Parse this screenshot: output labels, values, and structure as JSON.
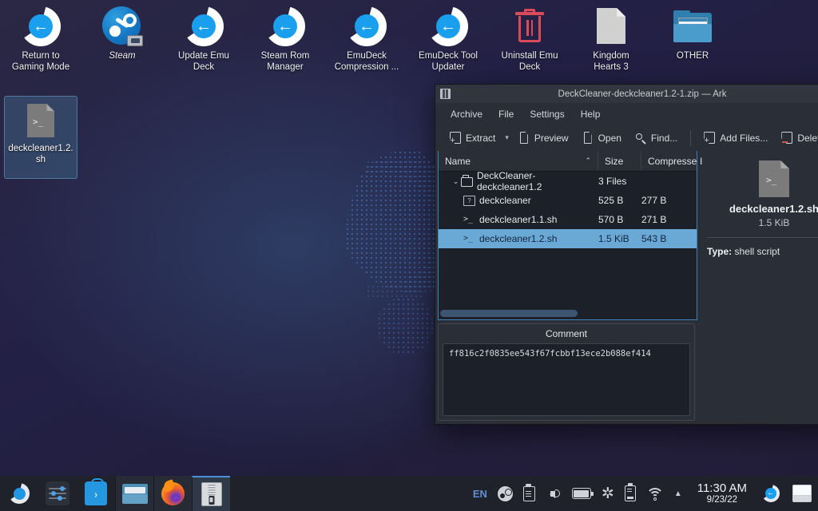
{
  "desktop": {
    "icons": [
      {
        "label": "Return to\nGaming Mode",
        "icon": "return-arrow-icon",
        "italic": false
      },
      {
        "label": "Steam",
        "icon": "steam-icon",
        "italic": true
      },
      {
        "label": "Update Emu\nDeck",
        "icon": "return-arrow-icon",
        "italic": false
      },
      {
        "label": "Steam Rom\nManager",
        "icon": "return-arrow-icon",
        "italic": false
      },
      {
        "label": "EmuDeck\nCompression ...",
        "icon": "return-arrow-icon",
        "italic": false
      },
      {
        "label": "EmuDeck Tool\nUpdater",
        "icon": "return-arrow-icon",
        "italic": false
      },
      {
        "label": "Uninstall Emu\nDeck",
        "icon": "trash-icon",
        "italic": false
      },
      {
        "label": "Kingdom\nHearts 3",
        "icon": "blank-document-icon",
        "italic": false
      },
      {
        "label": "OTHER",
        "icon": "folder-window-icon",
        "italic": false
      }
    ],
    "selected_file": {
      "label": "deckcleaner1.2.\nsh",
      "icon": "shell-script-icon",
      "prompt_glyph": ">_"
    }
  },
  "ark": {
    "title": "DeckCleaner-deckcleaner1.2-1.zip — Ark",
    "app_icon": "ark-icon",
    "menu": [
      "Archive",
      "File",
      "Settings",
      "Help"
    ],
    "toolbar": [
      {
        "label": "Extract",
        "icon": "extract-icon",
        "has_dropdown": true
      },
      {
        "label": "Preview",
        "icon": "preview-icon",
        "has_dropdown": false
      },
      {
        "label": "Open",
        "icon": "open-icon",
        "has_dropdown": false
      },
      {
        "label": "Find...",
        "icon": "search-icon",
        "has_dropdown": false
      },
      {
        "label": "Add Files...",
        "icon": "add-files-icon",
        "has_dropdown": false
      },
      {
        "label": "Delete",
        "icon": "delete-icon",
        "has_dropdown": false
      }
    ],
    "columns": [
      "Name",
      "Size",
      "Compressed"
    ],
    "sort_indicator": "⌃",
    "rows": [
      {
        "name": "DeckCleaner-deckcleaner1.2",
        "size": "3 Files",
        "compressed": "",
        "icon": "folder-icon",
        "depth": 0,
        "expanded": true,
        "selected": false
      },
      {
        "name": "deckcleaner",
        "size": "525 B",
        "compressed": "277 B",
        "icon": "unknown-file-icon",
        "depth": 1,
        "expanded": false,
        "selected": false
      },
      {
        "name": "deckcleaner1.1.sh",
        "size": "570 B",
        "compressed": "271 B",
        "icon": "shell-script-icon",
        "depth": 1,
        "expanded": false,
        "selected": false
      },
      {
        "name": "deckcleaner1.2.sh",
        "size": "1.5 KiB",
        "compressed": "543 B",
        "icon": "shell-script-icon",
        "depth": 1,
        "expanded": false,
        "selected": true
      }
    ],
    "comment": {
      "title": "Comment",
      "text": "ff816c2f0835ee543f67fcbbf13ece2b088ef414"
    },
    "details": {
      "file_name": "deckcleaner1.2.sh",
      "file_size": "1.5 KiB",
      "type_label": "Type:",
      "type_value": "shell script",
      "icon": "shell-script-icon",
      "prompt_glyph": ">_"
    }
  },
  "taskbar": {
    "launchers": [
      {
        "name": "application-launcher",
        "icon": "kde-start-icon"
      },
      {
        "name": "settings",
        "icon": "settings-sliders-icon"
      },
      {
        "name": "discover",
        "icon": "discover-store-icon"
      },
      {
        "name": "file-manager",
        "icon": "dolphin-folder-icon"
      },
      {
        "name": "firefox",
        "icon": "firefox-icon"
      }
    ],
    "tasks": [
      {
        "name": "ark",
        "icon": "zip-archive-icon",
        "active": true
      }
    ],
    "tray": {
      "language": "EN",
      "items": [
        {
          "name": "steam",
          "icon": "steam-tray-icon"
        },
        {
          "name": "clipboard",
          "icon": "clipboard-icon"
        },
        {
          "name": "volume",
          "icon": "volume-icon"
        },
        {
          "name": "battery",
          "icon": "battery-icon"
        },
        {
          "name": "bluetooth",
          "icon": "bluetooth-icon"
        },
        {
          "name": "removable-media",
          "icon": "usb-drive-icon"
        },
        {
          "name": "network",
          "icon": "wifi-icon"
        }
      ],
      "overflow_arrow": "▲"
    },
    "clock": {
      "time": "11:30 AM",
      "date": "9/23/22"
    },
    "return_to_gaming": {
      "name": "return-to-gaming-mode",
      "glyph": "←"
    },
    "show_desktop": {
      "name": "show-desktop"
    }
  },
  "colors": {
    "accent": "#3a82b8",
    "selection": "#6aa9d6",
    "window_bg": "#2a2e37",
    "list_bg": "#1c2029",
    "taskbar_bg": "#1f222b",
    "return_icon_blue": "#1a9fee",
    "trash_red": "#d94a5a"
  }
}
